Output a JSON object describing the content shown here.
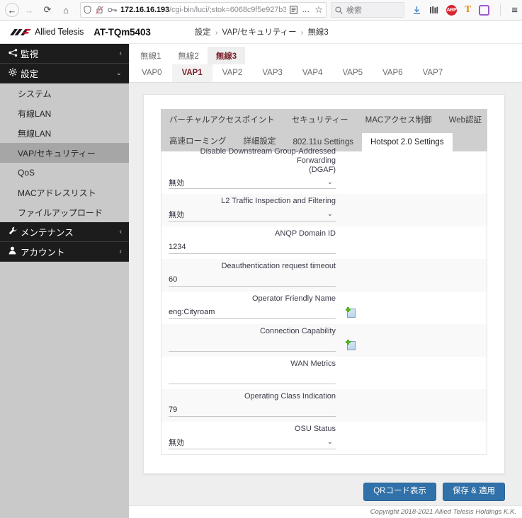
{
  "browser": {
    "nav": {
      "back": "←",
      "forward": "→",
      "reload": "⟳",
      "home": "⌂"
    },
    "url": {
      "host": "172.16.16.193",
      "path": "/cgi-bin/luci/;stok=6068c9f5e927b3",
      "shield_icon": "shield-icon",
      "tracking_icon": "tracking-protection-off-icon",
      "key_icon": "key-icon",
      "reader_icon": "reader-view-icon",
      "more_icon": "…",
      "bookmark_icon": "☆"
    },
    "search": {
      "placeholder": "検索",
      "icon": "search-icon"
    },
    "toolbar_icons": [
      {
        "name": "downloads-icon",
        "glyph": "⤓"
      },
      {
        "name": "library-icon",
        "glyph": "▥"
      },
      {
        "name": "adblock-plus-icon",
        "glyph": "ABP"
      },
      {
        "name": "tampermonkey-icon",
        "glyph": "T"
      },
      {
        "name": "extension-square-icon",
        "glyph": ""
      },
      {
        "name": "app-menu-icon",
        "glyph": "≡"
      }
    ]
  },
  "header": {
    "brand": "Allied Telesis",
    "model": "AT-TQm5403",
    "breadcrumb": {
      "item1": "設定",
      "item2": "VAP/セキュリティー",
      "item3": "無線3",
      "separator": "›"
    }
  },
  "sidebar": {
    "groups": [
      {
        "label": "監視",
        "icon": "monitor-icon",
        "glyph": "◄",
        "chevron": "‹",
        "expanded": false
      },
      {
        "label": "設定",
        "icon": "gear-icon",
        "glyph": "✿",
        "chevron": "⌄",
        "expanded": true
      }
    ],
    "settings_items": [
      {
        "label": "システム",
        "active": false
      },
      {
        "label": "有線LAN",
        "active": false
      },
      {
        "label": "無線LAN",
        "active": false
      },
      {
        "label": "VAP/セキュリティー",
        "active": true
      },
      {
        "label": "QoS",
        "active": false
      },
      {
        "label": "MACアドレスリスト",
        "active": false
      },
      {
        "label": "ファイルアップロード",
        "active": false
      }
    ],
    "bottom_groups": [
      {
        "label": "メンテナンス",
        "icon": "wrench-icon",
        "glyph": "✎",
        "chevron": "‹"
      },
      {
        "label": "アカウント",
        "icon": "user-icon",
        "glyph": "♟",
        "chevron": "‹"
      }
    ]
  },
  "main": {
    "radio_tabs": [
      {
        "label": "無線1",
        "active": false
      },
      {
        "label": "無線2",
        "active": false
      },
      {
        "label": "無線3",
        "active": true
      }
    ],
    "vap_tabs": [
      {
        "label": "VAP0",
        "active": false
      },
      {
        "label": "VAP1",
        "active": true
      },
      {
        "label": "VAP2",
        "active": false
      },
      {
        "label": "VAP3",
        "active": false
      },
      {
        "label": "VAP4",
        "active": false
      },
      {
        "label": "VAP5",
        "active": false
      },
      {
        "label": "VAP6",
        "active": false
      },
      {
        "label": "VAP7",
        "active": false
      }
    ],
    "inner_tabs_row1": [
      {
        "label": "バーチャルアクセスポイント",
        "active": false
      },
      {
        "label": "セキュリティー",
        "active": false
      },
      {
        "label": "MACアクセス制御",
        "active": false
      },
      {
        "label": "Web認証",
        "active": false
      }
    ],
    "inner_tabs_row2": [
      {
        "label": "高速ローミング",
        "active": false
      },
      {
        "label": "詳細設定",
        "active": false
      },
      {
        "label": "802.11u Settings",
        "active": false
      },
      {
        "label": "Hotspot 2.0 Settings",
        "active": true
      }
    ],
    "fields": [
      {
        "label_line1": "Disable Downstream Group-Addressed Forwarding",
        "label_line2": "(DGAF)",
        "type": "select",
        "value": "無効",
        "caret": "⌄",
        "has_add": false
      },
      {
        "label_line1": "L2 Traffic Inspection and Filtering",
        "label_line2": "",
        "type": "select",
        "value": "無効",
        "caret": "⌄",
        "has_add": false
      },
      {
        "label_line1": "ANQP Domain ID",
        "label_line2": "",
        "type": "text",
        "value": "1234",
        "caret": "",
        "has_add": false
      },
      {
        "label_line1": "Deauthentication request timeout",
        "label_line2": "",
        "type": "text",
        "value": "60",
        "caret": "",
        "has_add": false
      },
      {
        "label_line1": "Operator Friendly Name",
        "label_line2": "",
        "type": "text",
        "value": "eng:Cityroam",
        "caret": "",
        "has_add": true
      },
      {
        "label_line1": "Connection Capability",
        "label_line2": "",
        "type": "text",
        "value": "",
        "caret": "",
        "has_add": true
      },
      {
        "label_line1": "WAN Metrics",
        "label_line2": "",
        "type": "text",
        "value": "",
        "caret": "",
        "has_add": false
      },
      {
        "label_line1": "Operating Class Indication",
        "label_line2": "",
        "type": "text",
        "value": "79",
        "caret": "",
        "has_add": false
      },
      {
        "label_line1": "OSU Status",
        "label_line2": "",
        "type": "select",
        "value": "無効",
        "caret": "⌄",
        "has_add": false
      }
    ],
    "buttons": {
      "qr": "QRコード表示",
      "save": "保存 & 適用"
    }
  },
  "footer": {
    "copyright": "Copyright 2018-2021 Allied Telesis Holdings K.K."
  },
  "colors": {
    "accent_blue": "#3071a9",
    "active_tab_text": "#7a1f2b",
    "sidebar_group_bg": "#1c1c1c",
    "sidebar_bg": "#c9c9c9"
  }
}
